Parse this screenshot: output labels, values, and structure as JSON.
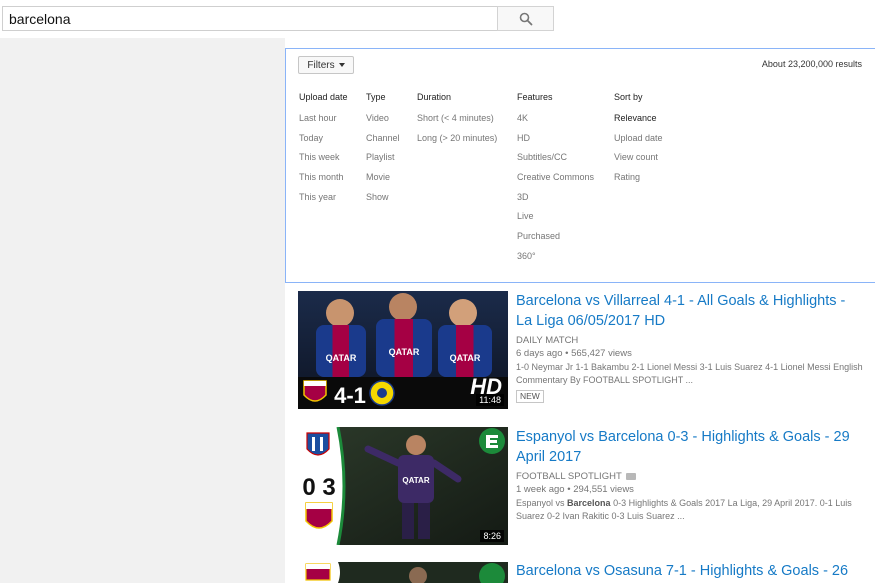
{
  "search": {
    "query": "barcelona"
  },
  "filters": {
    "button_label": "Filters",
    "results_count": "About 23,200,000 results",
    "columns": [
      {
        "heading": "Upload date",
        "options": [
          "Last hour",
          "Today",
          "This week",
          "This month",
          "This year"
        ]
      },
      {
        "heading": "Type",
        "options": [
          "Video",
          "Channel",
          "Playlist",
          "Movie",
          "Show"
        ]
      },
      {
        "heading": "Duration",
        "options": [
          "Short (< 4 minutes)",
          "Long (> 20 minutes)"
        ]
      },
      {
        "heading": "Features",
        "options": [
          "4K",
          "HD",
          "Subtitles/CC",
          "Creative Commons",
          "3D",
          "Live",
          "Purchased",
          "360°"
        ]
      },
      {
        "heading": "Sort by",
        "options": [
          "Relevance",
          "Upload date",
          "View count",
          "Rating"
        ],
        "selected": "Relevance"
      }
    ]
  },
  "results": [
    {
      "title": "Barcelona vs Villarreal 4-1 - All Goals & Highlights - La Liga 06/05/2017 HD",
      "channel": "DAILY MATCH",
      "age": "6 days ago",
      "views": "565,427 views",
      "description": "1-0 Neymar Jr 1-1 Bakambu 2-1 Lionel Messi 3-1 Luis Suarez 4-1 Lionel Messi English Commentary By FOOTBALL SPOTLIGHT ...",
      "badge": "NEW",
      "duration": "11:48",
      "thumb_score": "4-1",
      "thumb_hd": "HD",
      "thumb_sponsor": "QATAR"
    },
    {
      "title": "Espanyol vs Barcelona 0-3 - Highlights & Goals - 29 April 2017",
      "channel": "FOOTBALL SPOTLIGHT",
      "age": "1 week ago",
      "views": "294,551 views",
      "description_pre": "Espanyol vs ",
      "description_bold": "Barcelona",
      "description_post": " 0-3 Highlights & Goals 2017 La Liga, 29 April 2017. 0-1 Luis Suarez 0-2 Ivan Rakitic 0-3 Luis Suarez ...",
      "duration": "8:26",
      "thumb_score": "0 3",
      "thumb_sponsor": "QATAR"
    },
    {
      "title": "Barcelona vs Osasuna 7-1 - Highlights & Goals - 26"
    }
  ],
  "colors": {
    "link": "#167ac6",
    "panel_border": "#8ab4f8",
    "page_bg": "#f1f1f1"
  }
}
